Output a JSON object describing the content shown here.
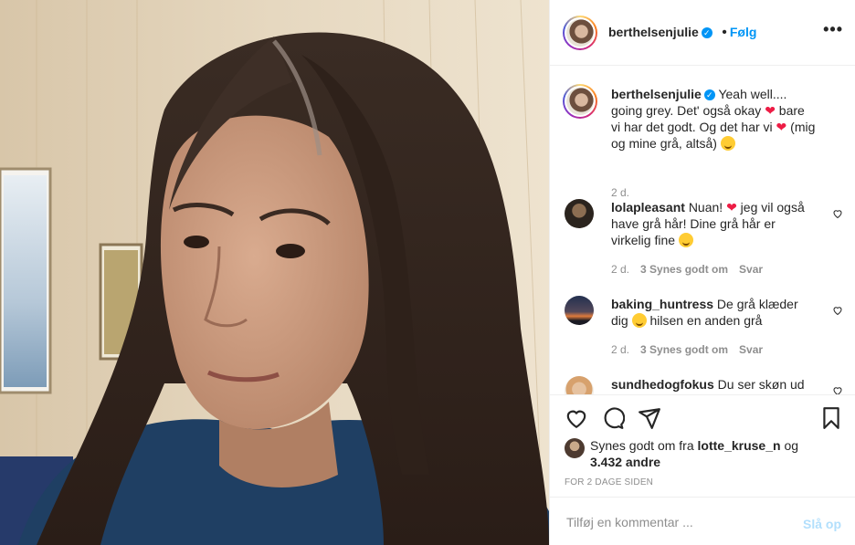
{
  "post": {
    "author": "berthelsenjulie",
    "follow_label": "Følg",
    "dot_sep": "•",
    "more_icon": "more-options-icon",
    "caption_text_1": "Yeah well.... going grey. Det' også okay ",
    "caption_text_2": " bare vi har det godt. Og det har vi ",
    "caption_text_3": " (mig og mine grå, altså) ",
    "caption_age": "2 d.",
    "heart_emoji": "❤",
    "colors": {
      "accent": "#0095f6",
      "muted": "#8e8e8e",
      "text": "#262626"
    }
  },
  "comments": [
    {
      "user": "lolapleasant",
      "text_1": "Nuan! ",
      "text_2": " jeg vil også have grå hår! Dine grå hår er virkelig fine ",
      "age": "2 d.",
      "likes": "3 Synes godt om",
      "reply": "Svar"
    },
    {
      "user": "baking_huntress",
      "text_1": "De grå klæder dig ",
      "text_2": " hilsen en anden grå",
      "age": "2 d.",
      "likes": "3 Synes godt om",
      "reply": "Svar"
    },
    {
      "user": "sundhedogfokus",
      "text_1": "Du ser skøn ud"
    }
  ],
  "likes": {
    "prefix": "Synes godt om fra ",
    "user": "lotte_kruse_n",
    "mid": " og ",
    "count": "3.432 andre"
  },
  "timestamp": "FOR 2 DAGE SIDEN",
  "add_comment": {
    "placeholder": "Tilføj en kommentar ...",
    "post_label": "Slå op"
  }
}
